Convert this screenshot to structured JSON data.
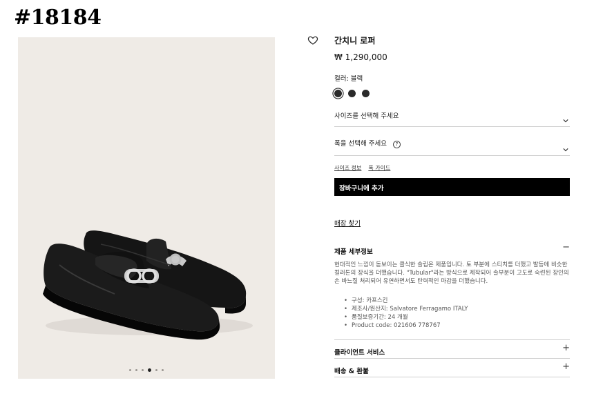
{
  "badge": "#18184",
  "product": {
    "title": "간치니 로퍼",
    "price": "₩ 1,290,000",
    "color_label": "컬러: 블랙",
    "swatches": [
      "black-selected",
      "black",
      "black"
    ]
  },
  "size_select": {
    "label": "사이즈를 선택해 주세요"
  },
  "width_select": {
    "label": "폭을 선택해 주세요",
    "help_icon": "?"
  },
  "links": {
    "size_info": "사이즈 정보",
    "width_guide": "폭 가이드"
  },
  "cart_button": "장바구니에 추가",
  "store_link": "매장 찾기",
  "details": {
    "heading": "제품 세부정보",
    "toggle": "−",
    "description": "현대적인 느낌이 돋보이는 클식한 슬립온 제품입니다. 토 부분에 스티치를 더했고 발등에 비슷한 컬러톤의 장식을 더했습니다. \"Tubular\"라는 방식으로 제작되어 솔부분이 고도로 숙련된 장인의 손 바느질 처리되어 유연하면서도 탄력적인 마감을 더했습니다.",
    "specs": [
      "구성: 카프스킨",
      "제조사/원산지: Salvatore Ferragamo ITALY",
      "품질보증기간: 24 개월",
      "Product code: 021606 778767"
    ]
  },
  "client_service": {
    "heading": "클라이언트 서비스",
    "toggle": "+"
  },
  "shipping": {
    "heading": "배송 & 환불",
    "toggle": "+"
  },
  "gallery": {
    "dot_count": 6,
    "active_dot": 4
  }
}
